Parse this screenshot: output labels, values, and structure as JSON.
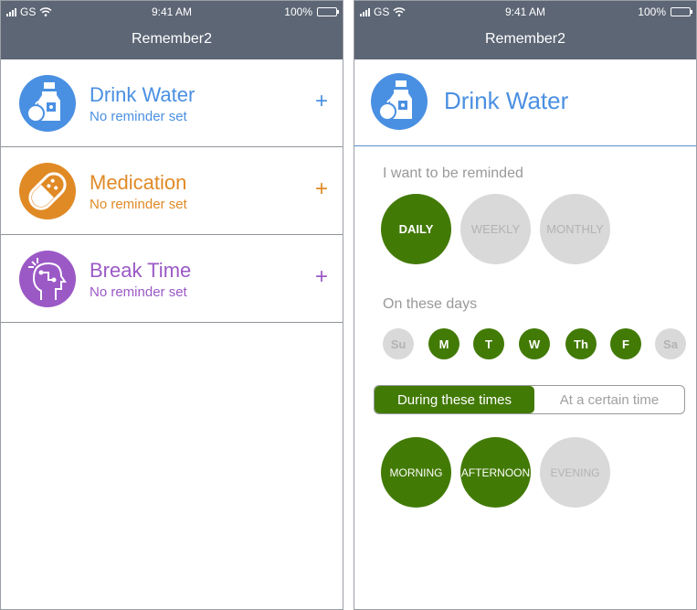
{
  "status_bar": {
    "carrier": "GS",
    "time": "9:41 AM",
    "battery_percent": "100%",
    "battery_level": 1.0
  },
  "app": {
    "title": "Remember2"
  },
  "reminders": [
    {
      "title": "Drink Water",
      "subtitle": "No reminder set",
      "action": "+",
      "color": "#4a90e2",
      "icon": "water-bottle-icon"
    },
    {
      "title": "Medication",
      "subtitle": "No reminder set",
      "action": "+",
      "color": "#e08a26",
      "icon": "pill-icon"
    },
    {
      "title": "Break Time",
      "subtitle": "No reminder set",
      "action": "+",
      "color": "#9b59c6",
      "icon": "head-circuit-icon"
    }
  ],
  "detail": {
    "title": "Drink Water",
    "icon": "water-bottle-icon",
    "frequency_label": "I want to be reminded",
    "frequency_options": [
      {
        "label": "DAILY",
        "selected": true
      },
      {
        "label": "WEEKLY",
        "selected": false
      },
      {
        "label": "MONTHLY",
        "selected": false
      }
    ],
    "days_label": "On these days",
    "days": [
      {
        "label": "Su",
        "selected": false
      },
      {
        "label": "M",
        "selected": true
      },
      {
        "label": "T",
        "selected": true
      },
      {
        "label": "W",
        "selected": true
      },
      {
        "label": "Th",
        "selected": true
      },
      {
        "label": "F",
        "selected": true
      },
      {
        "label": "Sa",
        "selected": false
      }
    ],
    "mode_tabs": [
      {
        "label": "During these times",
        "selected": true
      },
      {
        "label": "At a certain time",
        "selected": false
      }
    ],
    "time_options": [
      {
        "label": "MORNING",
        "selected": true
      },
      {
        "label": "AFTERNOON",
        "selected": true
      },
      {
        "label": "EVENING",
        "selected": false
      }
    ]
  },
  "colors": {
    "navbar": "#5d6675",
    "selected_green": "#427a06",
    "unselected_gray": "#d9d9d9",
    "water_blue": "#4a90e2",
    "medication_orange": "#e08a26",
    "break_purple": "#9b59c6"
  }
}
